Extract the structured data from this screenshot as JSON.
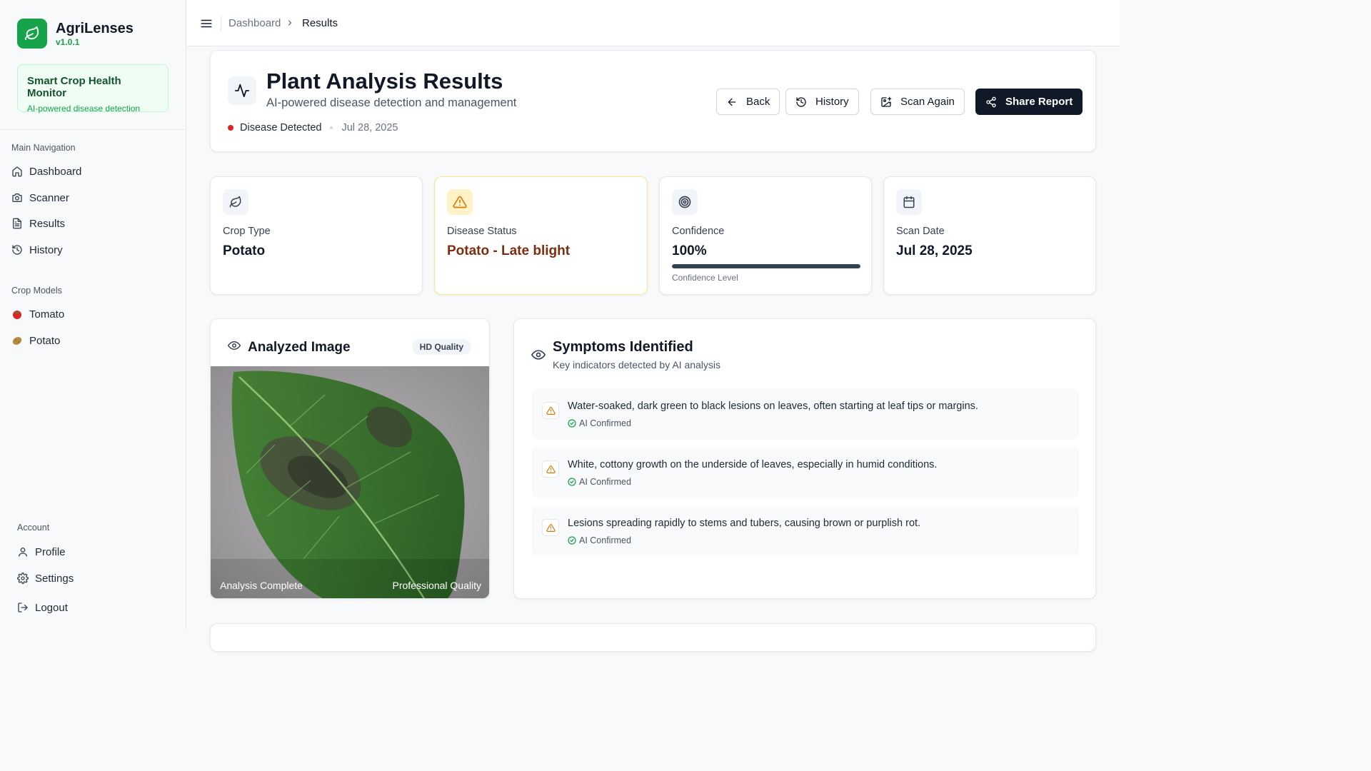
{
  "brand": {
    "name": "AgriLenses",
    "version": "v1.0.1"
  },
  "promo": {
    "title": "Smart Crop Health Monitor",
    "subtitle": "AI-powered disease detection"
  },
  "sidebar": {
    "main_heading": "Main Navigation",
    "main_items": [
      {
        "label": "Dashboard",
        "icon": "home-icon"
      },
      {
        "label": "Scanner",
        "icon": "camera-icon"
      },
      {
        "label": "Results",
        "icon": "file-text-icon"
      },
      {
        "label": "History",
        "icon": "history-icon"
      }
    ],
    "crops_heading": "Crop Models",
    "crop_items": [
      {
        "label": "Tomato",
        "icon": "tomato-icon"
      },
      {
        "label": "Potato",
        "icon": "potato-icon"
      }
    ],
    "account_heading": "Account",
    "account_items": [
      {
        "label": "Profile",
        "icon": "user-icon"
      },
      {
        "label": "Settings",
        "icon": "gear-icon"
      },
      {
        "label": "Logout",
        "icon": "logout-icon"
      }
    ]
  },
  "breadcrumb": {
    "parent": "Dashboard",
    "current": "Results"
  },
  "header": {
    "title": "Plant Analysis Results",
    "subtitle": "AI-powered disease detection and management",
    "status": "Disease Detected",
    "date": "Jul 28, 2025",
    "buttons": {
      "back": "Back",
      "history": "History",
      "scan_again": "Scan Again",
      "share": "Share Report"
    }
  },
  "stats": {
    "crop": {
      "label": "Crop Type",
      "value": "Potato"
    },
    "disease": {
      "label": "Disease Status",
      "value": "Potato - Late blight"
    },
    "confidence": {
      "label": "Confidence",
      "value": "100%",
      "level": 1.0,
      "caption": "Confidence Level"
    },
    "scan_date": {
      "label": "Scan Date",
      "value": "Jul 28, 2025"
    }
  },
  "image_card": {
    "title": "Analyzed Image",
    "badge": "HD Quality",
    "overlay_left": "Analysis Complete",
    "overlay_right": "Professional Quality"
  },
  "symptoms": {
    "title": "Symptoms Identified",
    "subtitle": "Key indicators detected by AI analysis",
    "confirmed_label": "AI Confirmed",
    "items": [
      "Water-soaked, dark green to black lesions on leaves, often starting at leaf tips or margins.",
      "White, cottony growth on the underside of leaves, especially in humid conditions.",
      "Lesions spreading rapidly to stems and tubers, causing brown or purplish rot."
    ]
  },
  "colors": {
    "brand": "#16a34a",
    "danger": "#dc2626",
    "warning": "#d97706",
    "primary_dark": "#111827"
  }
}
